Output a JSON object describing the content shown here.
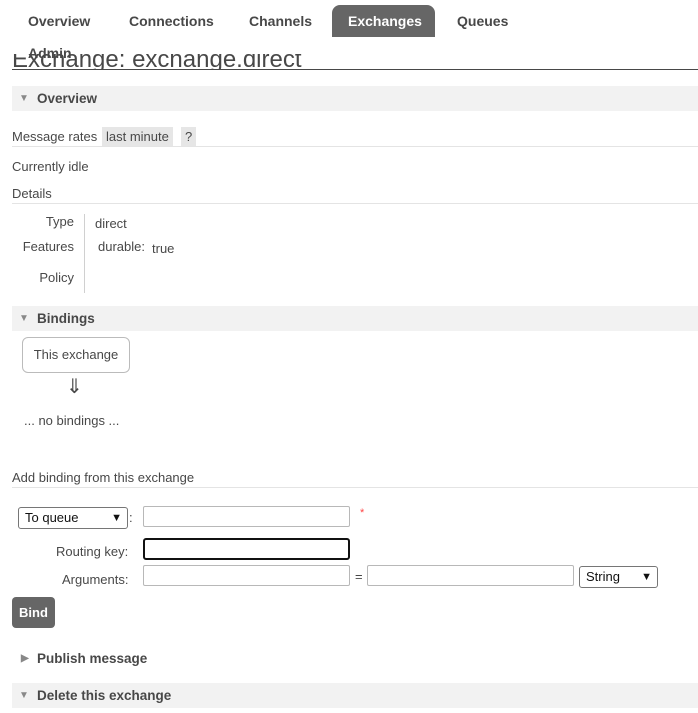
{
  "nav": {
    "tabs": [
      {
        "label": "Overview"
      },
      {
        "label": "Connections"
      },
      {
        "label": "Channels"
      },
      {
        "label": "Exchanges"
      },
      {
        "label": "Queues"
      },
      {
        "label": "Admin"
      }
    ],
    "active": "Exchanges"
  },
  "page": {
    "title": "Exchange: exchange.direct"
  },
  "overview": {
    "header": "Overview",
    "message_rates_label": "Message rates",
    "rate_period": "last minute",
    "help": "?",
    "idle_text": "Currently idle",
    "details_label": "Details",
    "details": {
      "type_label": "Type",
      "type_value": "direct",
      "features_label": "Features",
      "feature_key": "durable:",
      "feature_value": "true",
      "policy_label": "Policy"
    }
  },
  "bindings": {
    "header": "Bindings",
    "this_exchange": "This exchange",
    "arrow": "⇓",
    "no_bindings": "... no bindings ..."
  },
  "add_binding": {
    "title": "Add binding from this exchange",
    "destination_type": "To queue",
    "colon": ":",
    "required_mark": "*",
    "destination_value": "",
    "routing_key_label": "Routing key:",
    "routing_key_value": "",
    "arguments_label": "Arguments:",
    "arg_key_value": "",
    "equals": "=",
    "arg_value_value": "",
    "arg_type": "String",
    "bind_label": "Bind"
  },
  "publish": {
    "header": "Publish message"
  },
  "delete": {
    "header": "Delete this exchange"
  },
  "colors": {
    "nav_active_bg": "#666666",
    "section_bg": "#f2f2f2",
    "required_red": "#ff4444",
    "button_bg": "#666666"
  }
}
